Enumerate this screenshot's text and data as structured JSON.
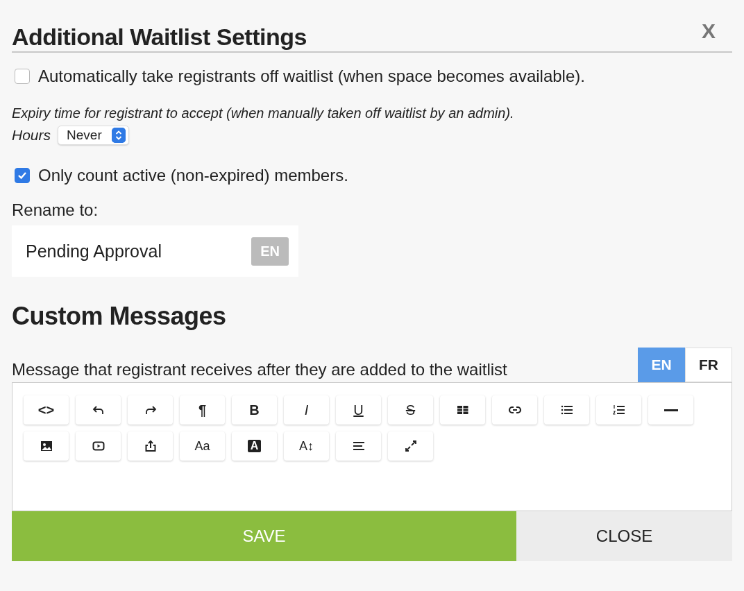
{
  "dialog": {
    "title": "Additional Waitlist Settings",
    "close_label": "X"
  },
  "auto_remove": {
    "label": "Automatically take registrants off waitlist (when space becomes available).",
    "checked": false
  },
  "expiry": {
    "note": "Expiry time for registrant to accept (when manually taken off waitlist by an admin).",
    "unit_label": "Hours",
    "value": "Never"
  },
  "active_only": {
    "label": "Only count active (non-expired) members.",
    "checked": true
  },
  "rename": {
    "label": "Rename to:",
    "value": "Pending Approval",
    "language": "EN"
  },
  "custom_messages": {
    "heading": "Custom Messages",
    "message_label": "Message that registrant receives after they are added to the waitlist",
    "languages": [
      {
        "label": "EN",
        "selected": true
      },
      {
        "label": "FR",
        "selected": false
      }
    ],
    "toolbar": [
      [
        {
          "kind": "bold",
          "label": "<>"
        },
        {
          "kind": "icon"
        },
        {
          "kind": "icon"
        },
        {
          "kind": "bold",
          "label": "¶"
        },
        {
          "kind": "bold",
          "label": "B"
        },
        {
          "kind": "italic",
          "label": "I"
        },
        {
          "kind": "underline",
          "label": "U"
        },
        {
          "kind": "strike",
          "label": "S"
        },
        {
          "kind": "icon"
        },
        {
          "kind": "icon"
        },
        {
          "kind": "icon"
        },
        {
          "kind": "icon"
        },
        {
          "kind": "icon"
        }
      ],
      [
        {
          "kind": "icon"
        },
        {
          "kind": "icon"
        },
        {
          "kind": "icon"
        },
        {
          "kind": "plain",
          "label": "Aa"
        },
        {
          "kind": "inverse",
          "label": "A"
        },
        {
          "kind": "plain",
          "label": "A↕"
        },
        {
          "kind": "icon"
        },
        {
          "kind": "icon"
        }
      ]
    ]
  },
  "buttons": [
    {
      "label": "SAVE",
      "kind": "primary"
    },
    {
      "label": "CLOSE",
      "kind": "secondary"
    }
  ]
}
